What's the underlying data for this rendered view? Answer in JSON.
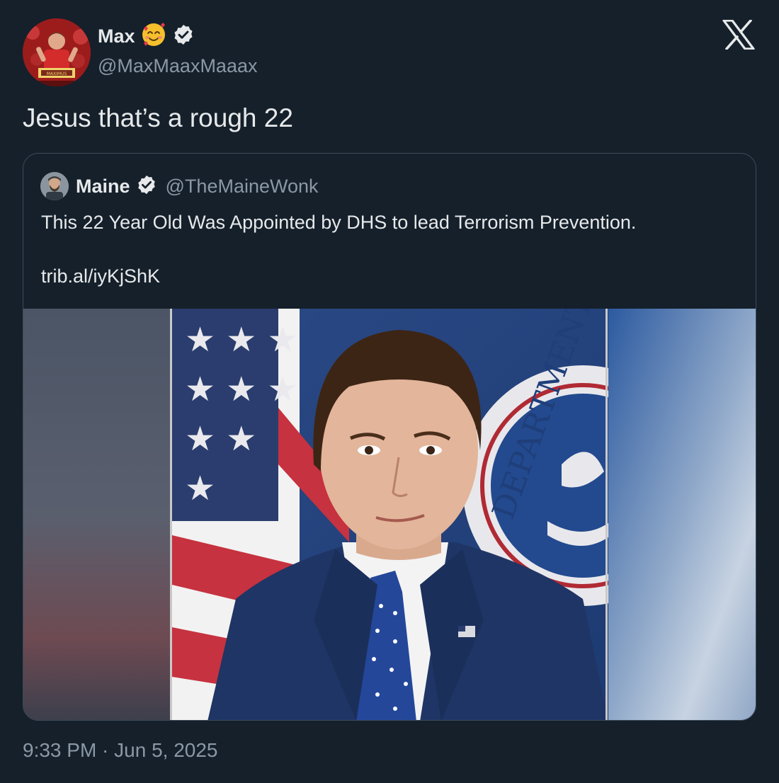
{
  "tweet": {
    "display_name": "Max",
    "emoji": "smiling-face-with-hearts",
    "handle": "@MaxMaaxMaaax",
    "verified": true,
    "text": "Jesus that’s a rough 22",
    "timestamp": "9:33 PM · Jun 5, 2025",
    "avatar_sign_text": "MAXIMUS"
  },
  "quoted": {
    "display_name": "Maine",
    "handle": "@TheMaineWonk",
    "verified": true,
    "text": "This 22 Year Old Was Appointed by DHS to lead Terrorism Prevention.",
    "link": "trib.al/iyKjShK"
  },
  "media": {
    "description": "portrait-photo",
    "seal_text": "DEPARTMENT"
  },
  "icons": {
    "brand": "x-logo-icon",
    "verified": "verified-badge-icon"
  },
  "colors": {
    "background": "#15202b",
    "text": "#e7e9ea",
    "secondary": "#8b98a5",
    "border": "#3d4b59"
  }
}
